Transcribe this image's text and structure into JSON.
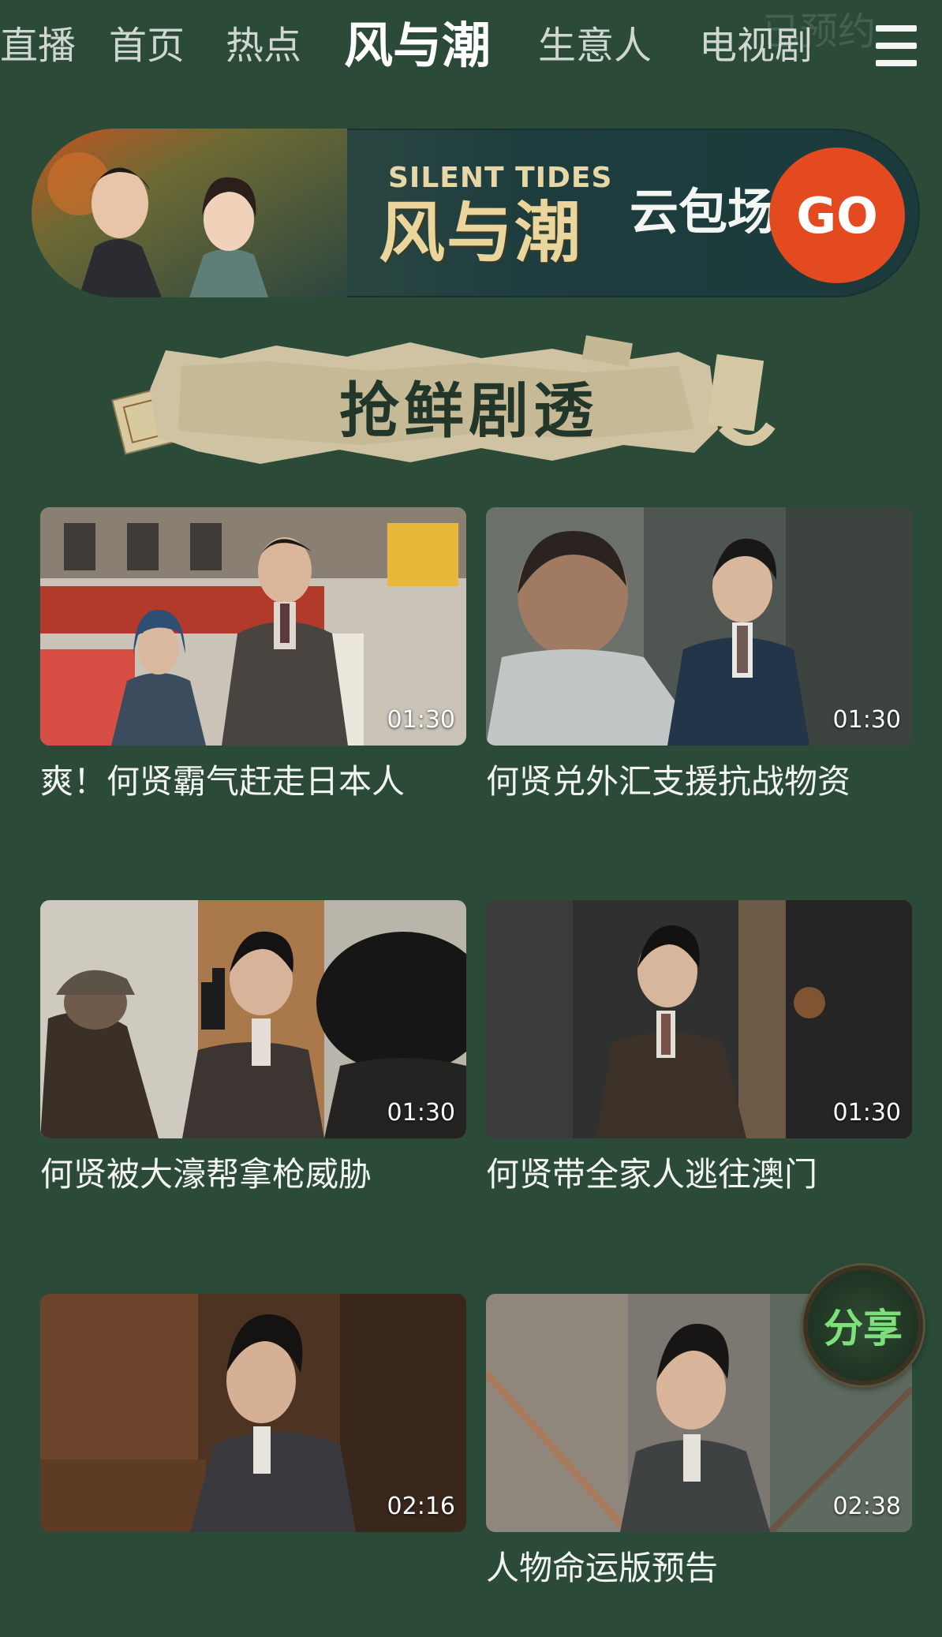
{
  "nav": {
    "tabs": [
      {
        "label": "直播",
        "active": false
      },
      {
        "label": "首页",
        "active": false
      },
      {
        "label": "热点",
        "active": false
      },
      {
        "label": "风与潮",
        "active": true
      },
      {
        "label": "生意人",
        "active": false
      },
      {
        "label": "电视剧",
        "active": false
      }
    ],
    "faded_right_text": "已预约",
    "menu_icon": "hamburger-menu-icon"
  },
  "banner": {
    "english_title": "SILENT TIDES",
    "chinese_title": "风与潮",
    "subtitle": "云包场",
    "go_label": "GO",
    "go_color": "#e34a1f"
  },
  "section": {
    "title": "抢鲜剧透"
  },
  "videos": [
    {
      "title": "爽！何贤霸气赶走日本人",
      "duration": "01:30"
    },
    {
      "title": "何贤兑外汇支援抗战物资",
      "duration": "01:30"
    },
    {
      "title": "何贤被大濠帮拿枪威胁",
      "duration": "01:30"
    },
    {
      "title": "何贤带全家人逃往澳门",
      "duration": "01:30"
    },
    {
      "title": "",
      "duration": "02:16"
    },
    {
      "title": "人物命运版预告",
      "duration": "02:38"
    }
  ],
  "share_badge": {
    "label": "分享"
  },
  "colors": {
    "background": "#2b4a38",
    "text": "#f3f5f2",
    "accent": "#e34a1f"
  }
}
